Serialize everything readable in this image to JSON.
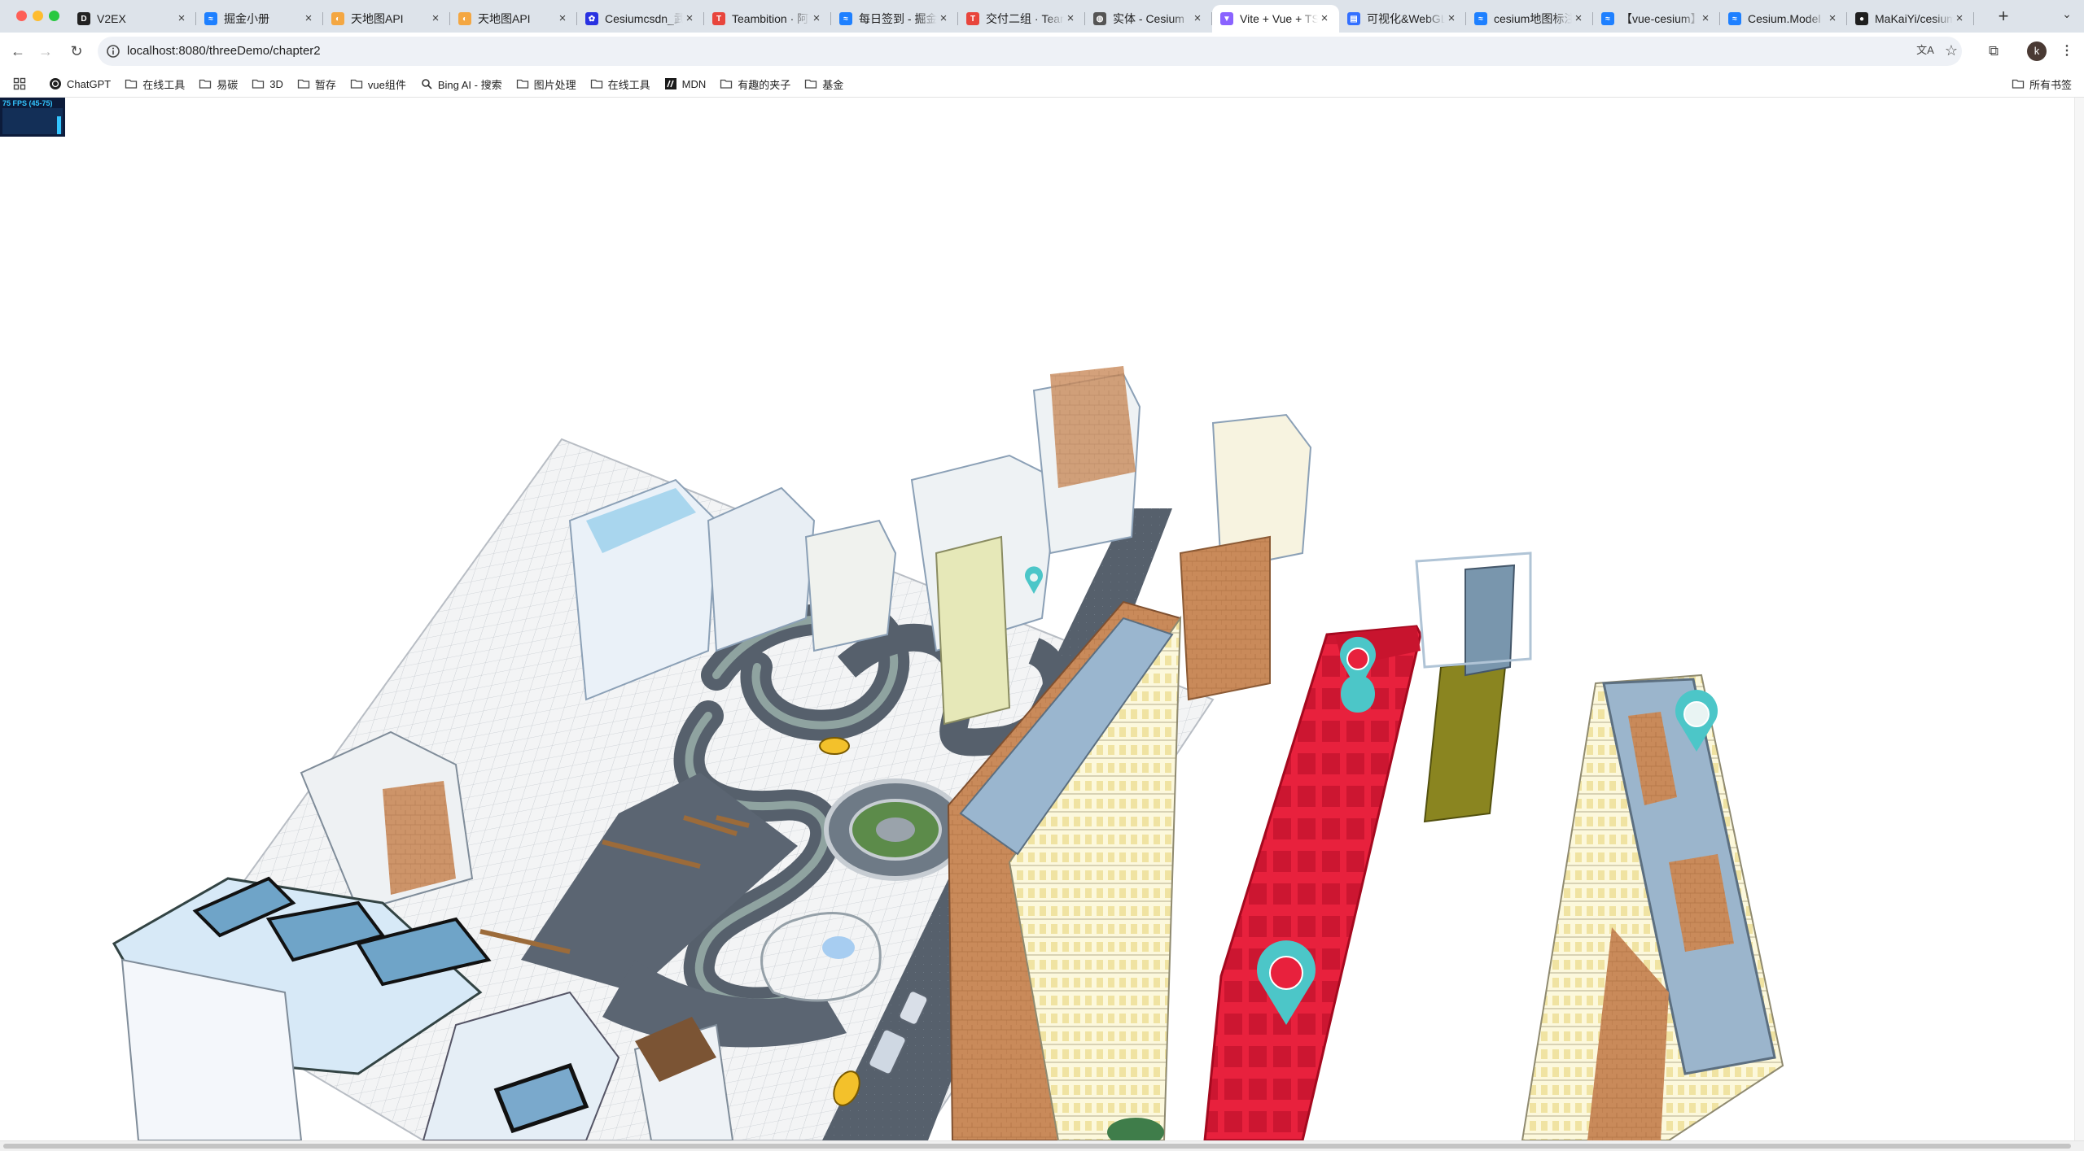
{
  "tabs": [
    {
      "title": "V2EX",
      "icon": "v2ex-icon",
      "color": "#222222"
    },
    {
      "title": "掘金小册",
      "icon": "juejin-icon",
      "color": "#1e80ff"
    },
    {
      "title": "天地图API",
      "icon": "tianditu-icon",
      "color": "#f4a742"
    },
    {
      "title": "天地图API",
      "icon": "tianditu-icon",
      "color": "#f4a742"
    },
    {
      "title": "Cesiumcsdn_武",
      "icon": "baidu-icon",
      "color": "#2932e1"
    },
    {
      "title": "Teambition · 阿",
      "icon": "teambition-icon",
      "color": "#e8453c"
    },
    {
      "title": "每日签到 - 掘金",
      "icon": "juejin-icon",
      "color": "#1e80ff"
    },
    {
      "title": "交付二组 · Team",
      "icon": "teambition-icon",
      "color": "#e8453c"
    },
    {
      "title": "实体 - Cesium",
      "icon": "globe-icon",
      "color": "#555555"
    },
    {
      "title": "Vite + Vue + TS",
      "icon": "vite-icon",
      "color": "#8a63ff",
      "active": true
    },
    {
      "title": "可视化&WebGL",
      "icon": "doc-icon",
      "color": "#3370ff"
    },
    {
      "title": "cesium地图标注",
      "icon": "juejin-icon",
      "color": "#1e80ff"
    },
    {
      "title": "【vue-cesium】",
      "icon": "juejin-icon",
      "color": "#1e80ff"
    },
    {
      "title": "Cesium.Model",
      "icon": "juejin-icon",
      "color": "#1e80ff"
    },
    {
      "title": "MaKaiYi/cesium",
      "icon": "github-icon",
      "color": "#1f1f1f"
    }
  ],
  "toolbar": {
    "url": "localhost:8080/threeDemo/chapter2",
    "avatar_letter": "k"
  },
  "bookmarks": [
    {
      "label": "ChatGPT",
      "icon": "chatgpt-icon"
    },
    {
      "label": "在线工具",
      "icon": "folder-icon"
    },
    {
      "label": "易碳",
      "icon": "folder-icon"
    },
    {
      "label": "3D",
      "icon": "folder-icon"
    },
    {
      "label": "暂存",
      "icon": "folder-icon"
    },
    {
      "label": "vue组件",
      "icon": "folder-icon"
    },
    {
      "label": "Bing AI - 搜索",
      "icon": "search-icon"
    },
    {
      "label": "图片处理",
      "icon": "folder-icon"
    },
    {
      "label": "在线工具",
      "icon": "folder-icon"
    },
    {
      "label": "MDN",
      "icon": "mdn-icon"
    },
    {
      "label": "有趣的夹子",
      "icon": "folder-icon"
    },
    {
      "label": "基金",
      "icon": "folder-icon"
    }
  ],
  "all_bookmarks_label": "所有书签",
  "stats": {
    "fps_text": "75 FPS (45-75)"
  },
  "colors": {
    "highlight_building": "#e8213d",
    "marker": "#4cc6c8",
    "ground_tile": "#f2f4f6",
    "road": "#55606d"
  }
}
